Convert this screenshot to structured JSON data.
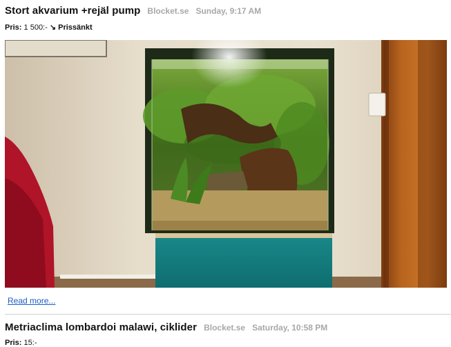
{
  "items": [
    {
      "title": "Stort akvarium +rejäl pump",
      "source": "Blocket.se",
      "time": "Sunday, 9:17 AM",
      "price_label": "Pris:",
      "price_value": "1 500:-",
      "price_arrow": "↘",
      "price_note": "Prissänkt",
      "read_more": "Read more..."
    },
    {
      "title": "Metriaclima lombardoi malawi, ciklider",
      "source": "Blocket.se",
      "time": "Saturday, 10:58 PM",
      "price_label": "Pris:",
      "price_value": "15:-"
    }
  ]
}
